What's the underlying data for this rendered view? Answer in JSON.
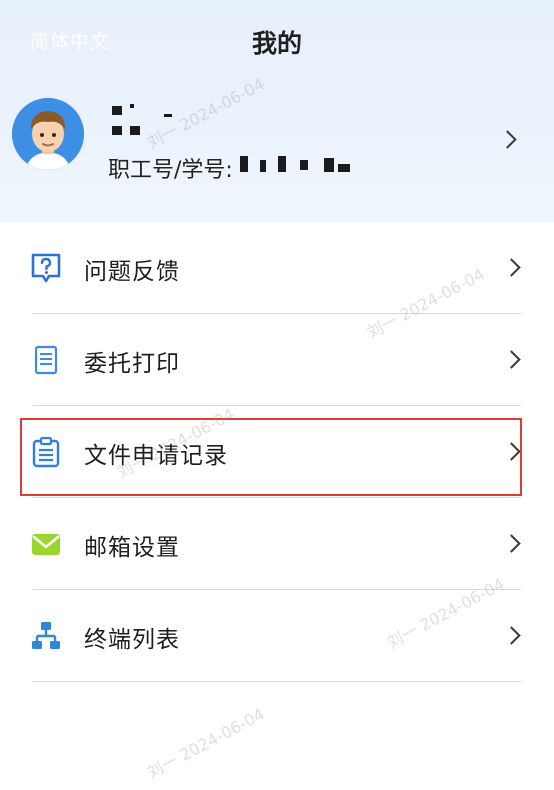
{
  "header": {
    "lang_switch": "简体中文",
    "title": "我的"
  },
  "profile": {
    "staff_label": "职工号/学号:"
  },
  "menu": {
    "items": [
      {
        "label": "问题反馈",
        "icon": "feedback-question-icon"
      },
      {
        "label": "委托打印",
        "icon": "document-print-icon"
      },
      {
        "label": "文件申请记录",
        "icon": "clipboard-record-icon"
      },
      {
        "label": "邮箱设置",
        "icon": "mail-envelope-icon"
      },
      {
        "label": "终端列表",
        "icon": "terminal-network-icon"
      }
    ]
  },
  "watermark": {
    "text": "刘一 2024-06-04"
  },
  "colors": {
    "header_bg": "#e9f1fc",
    "accent_blue": "#2f7fe0",
    "mail_green": "#9bd62e",
    "highlight_red": "#e03b32"
  }
}
